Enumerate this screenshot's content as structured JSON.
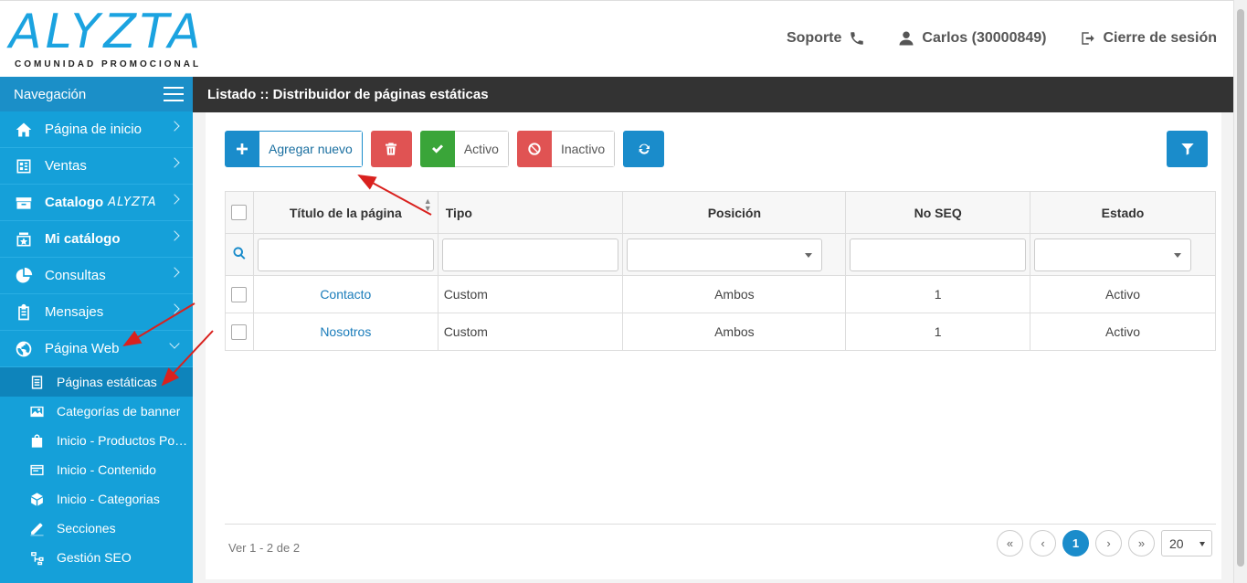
{
  "header": {
    "logo_text": "ALYZTA",
    "logo_subtitle": "COMUNIDAD PROMOCIONAL",
    "support_label": "Soporte",
    "user_label": "Carlos (30000849)",
    "logout_label": "Cierre de sesión"
  },
  "sidebar": {
    "title": "Navegación",
    "items": [
      {
        "label": "Página de inicio",
        "icon": "home-icon"
      },
      {
        "label": "Ventas",
        "icon": "ventas-icon"
      },
      {
        "label": "Catalogo",
        "brand": "ALYZTA",
        "icon": "catalog-icon"
      },
      {
        "label": "Mi catálogo",
        "icon": "star-box-icon"
      },
      {
        "label": "Consultas",
        "icon": "pie-icon"
      },
      {
        "label": "Mensajes",
        "icon": "clipboard-icon"
      },
      {
        "label": "Página Web",
        "icon": "globe-icon"
      }
    ],
    "subitems": [
      {
        "label": "Páginas estáticas",
        "icon": "document-icon"
      },
      {
        "label": "Categorías de banner",
        "icon": "image-icon"
      },
      {
        "label": "Inicio - Productos Populares",
        "icon": "shopping-bag-icon"
      },
      {
        "label": "Inicio - Contenido",
        "icon": "content-icon"
      },
      {
        "label": "Inicio - Categorias",
        "icon": "cube-icon"
      },
      {
        "label": "Secciones",
        "icon": "pencil-icon"
      },
      {
        "label": "Gestión SEO",
        "icon": "sitemap-icon"
      }
    ]
  },
  "main": {
    "title": "Listado :: Distribuidor de páginas estáticas",
    "toolbar": {
      "add_label": "Agregar nuevo",
      "active_label": "Activo",
      "inactive_label": "Inactivo"
    },
    "table": {
      "columns": [
        "Título de la página",
        "Tipo",
        "Posición",
        "No SEQ",
        "Estado"
      ],
      "rows": [
        {
          "titulo": "Contacto",
          "tipo": "Custom",
          "posicion": "Ambos",
          "seq": "1",
          "estado": "Activo"
        },
        {
          "titulo": "Nosotros",
          "tipo": "Custom",
          "posicion": "Ambos",
          "seq": "1",
          "estado": "Activo"
        }
      ]
    },
    "footer": {
      "info": "Ver 1 - 2 de 2",
      "first": "«",
      "prev": "‹",
      "current_page": "1",
      "next": "›",
      "last": "»",
      "page_size": "20"
    }
  },
  "colors": {
    "sidebar": "#15a0d9",
    "primary": "#1a8ccb",
    "danger": "#e05353",
    "success": "#3aa539",
    "titlebar": "#333333",
    "annotation_arrow": "#d9211e"
  }
}
